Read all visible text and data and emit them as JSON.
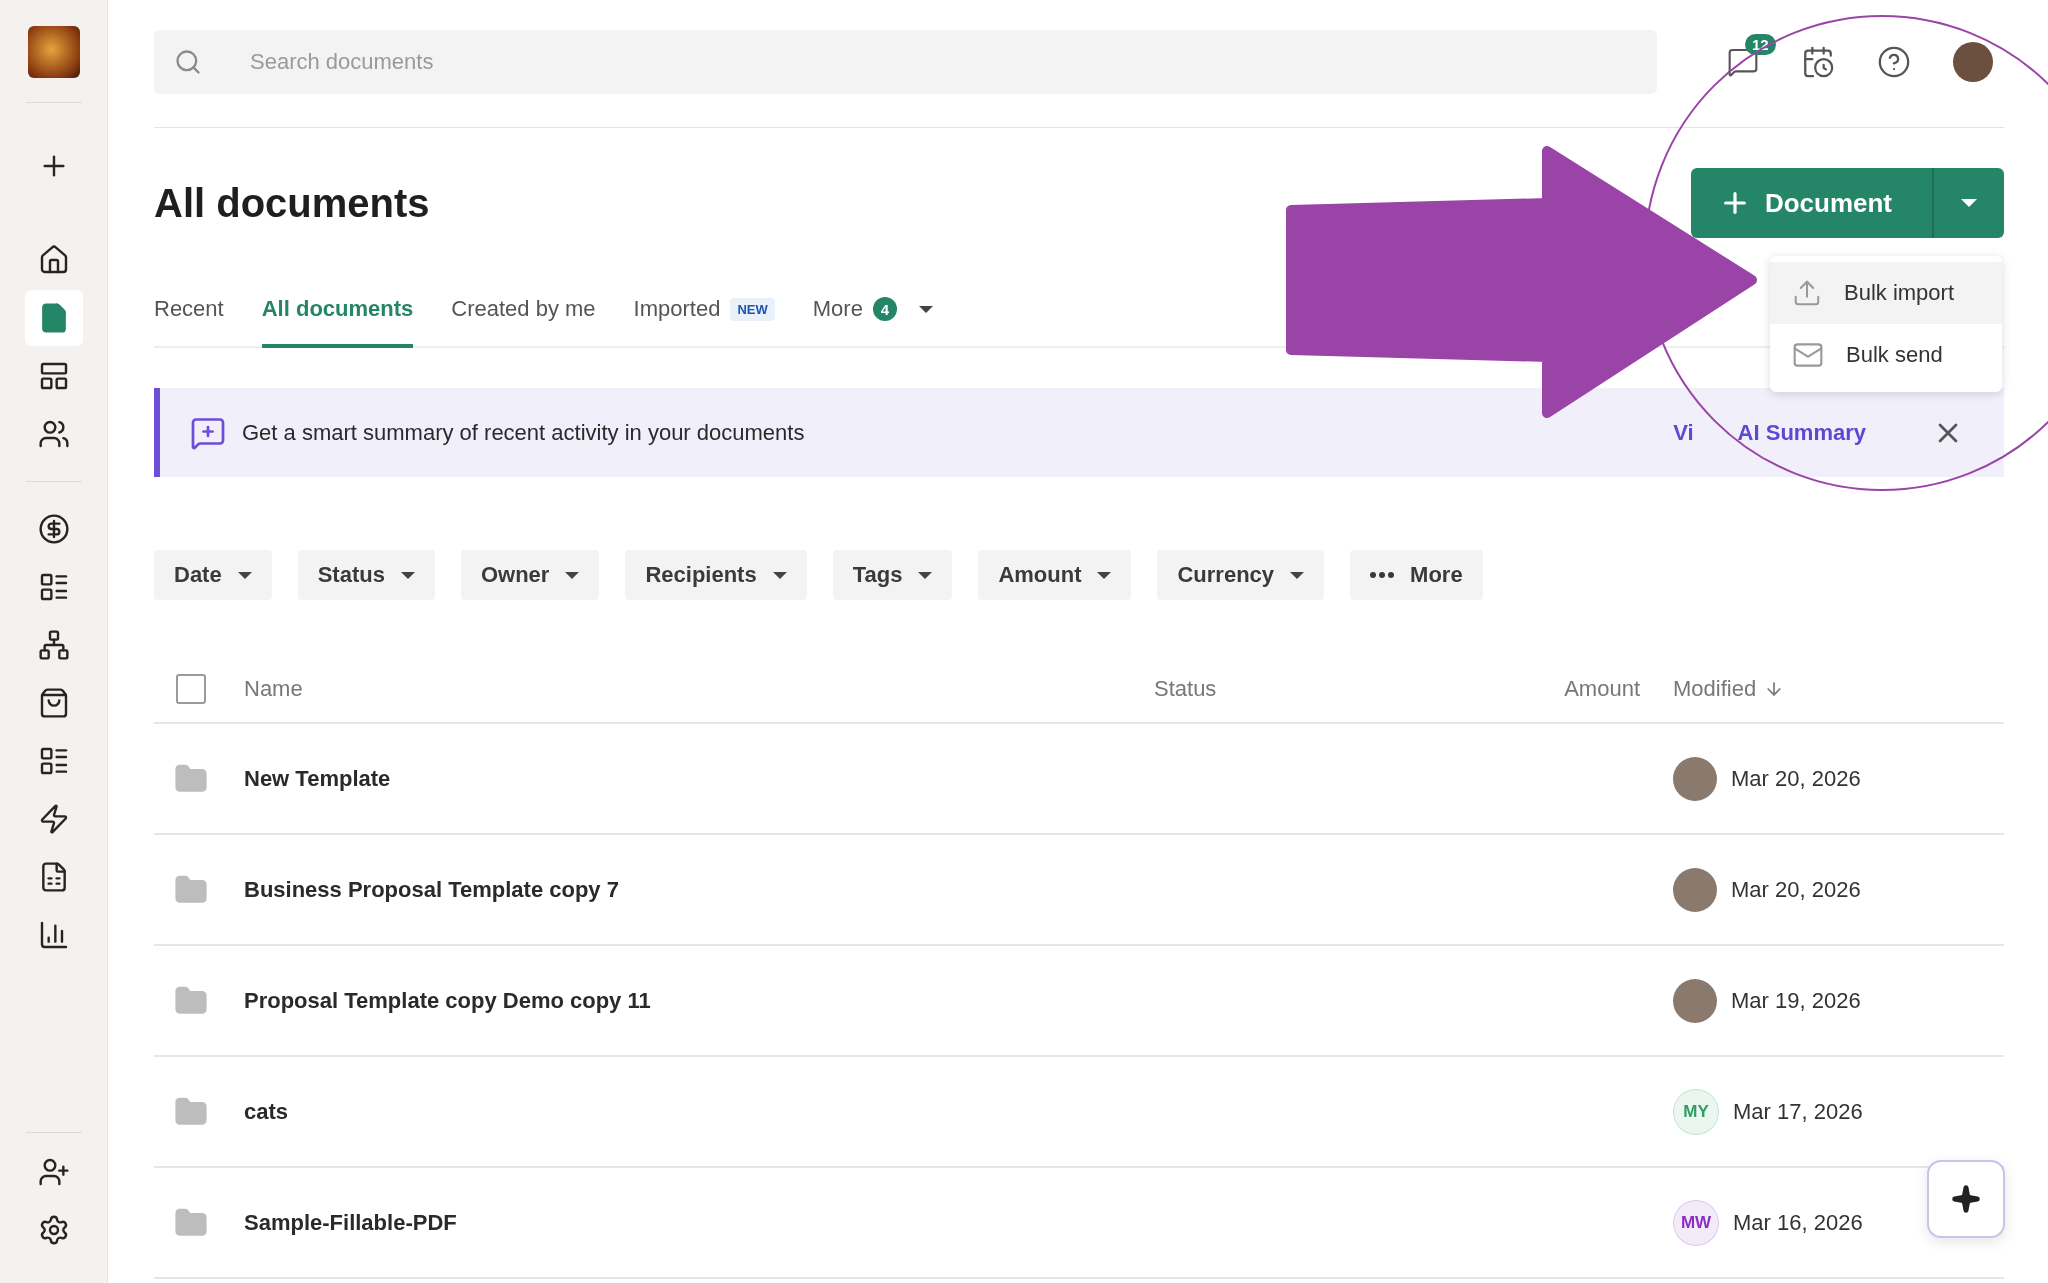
{
  "sidebar": {
    "top": [
      {
        "selected": false
      }
    ],
    "main": [
      {
        "selected": false
      },
      {
        "selected": true
      },
      {
        "selected": false
      },
      {
        "selected": false
      }
    ],
    "tools": [
      {
        "selected": false
      },
      {
        "selected": false
      },
      {
        "selected": false
      },
      {
        "selected": false
      },
      {
        "selected": false
      },
      {
        "selected": false
      },
      {
        "selected": false
      },
      {
        "selected": false
      }
    ],
    "bottom": [
      {
        "selected": false
      },
      {
        "selected": false
      }
    ]
  },
  "search": {
    "placeholder": "Search documents"
  },
  "notifications": {
    "count": "12"
  },
  "title": "All documents",
  "new_button": {
    "label": "Document",
    "menu": [
      {
        "label": "Bulk import",
        "selected": true
      },
      {
        "label": "Bulk send",
        "selected": false
      }
    ]
  },
  "tabs": [
    {
      "label": "Recent",
      "selected": false
    },
    {
      "label": "All documents",
      "selected": true
    },
    {
      "label": "Created by me",
      "selected": false
    },
    {
      "label": "Imported",
      "selected": false,
      "badge": "NEW"
    },
    {
      "label": "More",
      "selected": false,
      "count": "4"
    }
  ],
  "banner": {
    "text": "Get a smart summary of recent activity in your documents",
    "link_partial": "Vi",
    "link": "AI Summary"
  },
  "filters": [
    {
      "label": "Date",
      "kind": "dropdown"
    },
    {
      "label": "Status",
      "kind": "dropdown"
    },
    {
      "label": "Owner",
      "kind": "dropdown"
    },
    {
      "label": "Recipients",
      "kind": "dropdown"
    },
    {
      "label": "Tags",
      "kind": "dropdown"
    },
    {
      "label": "Amount",
      "kind": "dropdown"
    },
    {
      "label": "Currency",
      "kind": "dropdown"
    },
    {
      "label": "More",
      "kind": "more"
    }
  ],
  "table": {
    "select_all": {
      "checked": false
    },
    "columns": [
      {
        "label": "Name",
        "sorted": false
      },
      {
        "label": "Status",
        "sorted": false
      },
      {
        "label": "Amount",
        "sorted": false
      },
      {
        "label": "Modified",
        "sorted": true
      }
    ],
    "rows": [
      {
        "name": "New Template",
        "owner": {
          "kind": "photo"
        },
        "modified": "Mar 20, 2026"
      },
      {
        "name": "Business Proposal Template copy 7",
        "owner": {
          "kind": "photo"
        },
        "modified": "Mar 20, 2026"
      },
      {
        "name": "Proposal Template copy Demo copy 11",
        "owner": {
          "kind": "photo"
        },
        "modified": "Mar 19, 2026"
      },
      {
        "name": "cats",
        "owner": {
          "kind": "initials",
          "text": "MY",
          "color": "#2f9e5f"
        },
        "modified": "Mar 17, 2026"
      },
      {
        "name": "Sample-Fillable-PDF",
        "owner": {
          "kind": "initials",
          "text": "MW",
          "color": "#8a2fc0"
        },
        "modified": "Mar 16, 2026"
      }
    ]
  }
}
